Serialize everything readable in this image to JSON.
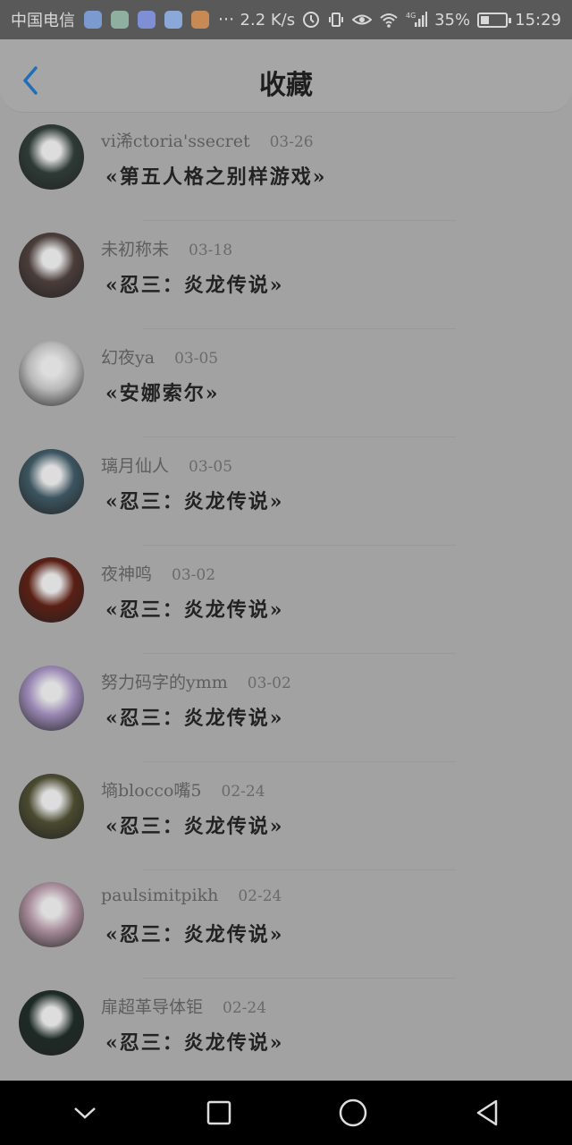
{
  "status_bar": {
    "carrier": "中国电信",
    "more": "···",
    "speed": "2.2 K/s",
    "network": "4G",
    "battery": "35%",
    "battery_level": 0.35,
    "time": "15:29",
    "app_icons": [
      {
        "name": "app-icon-1",
        "color": "#7a9ad0"
      },
      {
        "name": "app-icon-2",
        "color": "#8fb0a0"
      },
      {
        "name": "app-icon-3",
        "color": "#7f8fd6"
      },
      {
        "name": "app-icon-4",
        "color": "#8aa8d8"
      },
      {
        "name": "app-icon-5",
        "color": "#c78a55"
      }
    ]
  },
  "header": {
    "title": "收藏",
    "back_icon": "chevron-left-icon",
    "accent_color": "#1f6fb8"
  },
  "items": [
    {
      "author": "vi浠ctoria'ssecret",
      "date": "03-26",
      "title": "«第五人格之别样游戏»",
      "avatar_color": "#2e3a35"
    },
    {
      "author": "未初称未",
      "date": "03-18",
      "title": "«忍三：炎龙传说»",
      "avatar_color": "#4a3d3a"
    },
    {
      "author": "幻夜ya",
      "date": "03-05",
      "title": "«安娜索尔»",
      "avatar_color": "#b8b8b8"
    },
    {
      "author": "璃月仙人",
      "date": "03-05",
      "title": "«忍三：炎龙传说»",
      "avatar_color": "#3c5560"
    },
    {
      "author": "夜神鸣",
      "date": "03-02",
      "title": "«忍三：炎龙传说»",
      "avatar_color": "#5a1f14"
    },
    {
      "author": "努力码字的ymm",
      "date": "03-02",
      "title": "«忍三：炎龙传说»",
      "avatar_color": "#9a88b4"
    },
    {
      "author": "墒blocco嘴5",
      "date": "02-24",
      "title": "«忍三：炎龙传说»",
      "avatar_color": "#4a4a30"
    },
    {
      "author": "paulsimitpikh",
      "date": "02-24",
      "title": "«忍三：炎龙传说»",
      "avatar_color": "#a88c9a"
    },
    {
      "author": "扉超革导体钜",
      "date": "02-24",
      "title": "«忍三：炎龙传说»",
      "avatar_color": "#1e2a26"
    }
  ],
  "nav_bar": {
    "buttons": [
      "chevron-down-icon",
      "square-icon",
      "circle-icon",
      "triangle-back-icon"
    ]
  }
}
